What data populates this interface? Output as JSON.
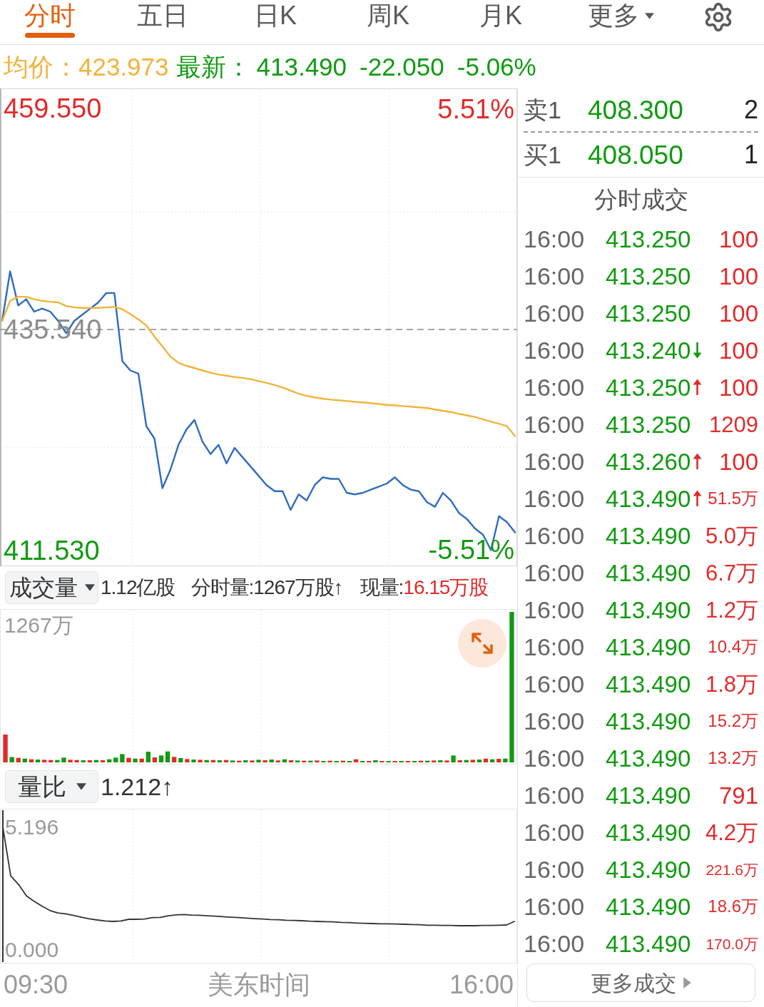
{
  "tabs": [
    {
      "label": "分时",
      "selected": true,
      "kind": "tab"
    },
    {
      "label": "五日",
      "selected": false,
      "kind": "tab"
    },
    {
      "label": "日K",
      "selected": false,
      "kind": "tab"
    },
    {
      "label": "周K",
      "selected": false,
      "kind": "tab"
    },
    {
      "label": "月K",
      "selected": false,
      "kind": "tab"
    },
    {
      "label": "更多",
      "selected": false,
      "kind": "menu"
    }
  ],
  "quote": {
    "avg_label": "均价：",
    "avg": "423.973",
    "last_label": "最新：",
    "last": "413.490",
    "change": "-22.050",
    "change_pct": "-5.06%"
  },
  "price_chart": {
    "pct_high": "5.51%",
    "pct_low": "-5.51%",
    "chart_data": {
      "type": "line",
      "ylim": [
        409.82,
        461.73
      ],
      "yticks": [
        {
          "value": 459.55,
          "label": "459.550"
        },
        {
          "value": 435.54,
          "label": "435.540"
        },
        {
          "value": 411.53,
          "label": "411.530"
        }
      ],
      "ref_lines": [
        {
          "axis": "y",
          "value": 435.54
        }
      ],
      "series": [
        {
          "color": "#2e6cc0",
          "values": [
            436.47,
            441.86,
            438.16,
            438.83,
            437.48,
            437.82,
            437.48,
            436.47,
            435.13,
            436.47,
            437.15,
            437.82,
            438.49,
            439.5,
            439.5,
            432.1,
            431.09,
            430.75,
            425.03,
            423.69,
            418.3,
            420.32,
            423.01,
            424.69,
            425.71,
            423.35,
            422.01,
            423.01,
            421.0,
            422.68,
            421.67,
            420.66,
            419.65,
            418.64,
            417.97,
            417.97,
            415.95,
            417.63,
            416.96,
            418.64,
            419.48,
            419.31,
            419.31,
            417.8,
            417.63,
            417.8,
            418.14,
            418.47,
            418.81,
            419.48,
            418.64,
            418.14,
            417.97,
            416.79,
            416.28,
            417.8,
            416.96,
            415.61,
            414.94,
            413.93,
            413.25,
            411.57,
            415.27,
            414.6,
            413.49
          ]
        },
        {
          "color": "#f0b43a",
          "values": [
            436.47,
            438.66,
            439.1,
            439.1,
            438.83,
            438.66,
            438.56,
            438.49,
            438.09,
            437.95,
            437.88,
            437.88,
            437.88,
            437.95,
            437.99,
            437.75,
            437.21,
            436.64,
            435.97,
            434.79,
            433.71,
            432.6,
            431.93,
            431.59,
            431.36,
            431.09,
            430.85,
            430.65,
            430.52,
            430.38,
            430.28,
            430.15,
            429.94,
            429.74,
            429.51,
            429.24,
            428.9,
            428.56,
            428.33,
            428.16,
            428.03,
            427.92,
            427.86,
            427.76,
            427.69,
            427.62,
            427.55,
            427.45,
            427.35,
            427.29,
            427.22,
            427.15,
            427.08,
            427.02,
            426.85,
            426.71,
            426.58,
            426.38,
            426.21,
            426.04,
            425.77,
            425.54,
            425.3,
            425.03,
            423.97
          ]
        }
      ]
    }
  },
  "volume": {
    "selector": "成交量",
    "total": "1.12亿股",
    "minute_volume": "分时量:1267万股↑",
    "current_label": "现量:",
    "current": "16.15万股",
    "max_label": "1267万"
  },
  "ratio": {
    "selector": "量比",
    "value": "1.212↑",
    "chart_data": {
      "type": "line",
      "ylim": [
        -0.54,
        5.95
      ],
      "yticks": [
        {
          "value": 5.196,
          "label": "5.196"
        },
        {
          "value": 0,
          "label": "0.000"
        }
      ],
      "series": [
        {
          "color": "#333333",
          "values": [
            5.196,
            3.14,
            2.77,
            2.29,
            2.06,
            1.85,
            1.67,
            1.57,
            1.53,
            1.46,
            1.39,
            1.32,
            1.27,
            1.23,
            1.21,
            1.23,
            1.3,
            1.3,
            1.31,
            1.37,
            1.38,
            1.45,
            1.49,
            1.5,
            1.48,
            1.47,
            1.45,
            1.43,
            1.41,
            1.39,
            1.37,
            1.35,
            1.33,
            1.31,
            1.29,
            1.28,
            1.26,
            1.25,
            1.24,
            1.22,
            1.21,
            1.2,
            1.19,
            1.17,
            1.16,
            1.14,
            1.13,
            1.12,
            1.11,
            1.11,
            1.1,
            1.09,
            1.08,
            1.07,
            1.05,
            1.05,
            1.04,
            1.04,
            1.03,
            1.03,
            1.03,
            1.04,
            1.04,
            1.05,
            1.06,
            1.21
          ]
        }
      ]
    }
  },
  "time_axis": [
    "09:30",
    "美东时间",
    "16:00"
  ],
  "order_book": [
    {
      "label": "卖1",
      "price": "408.300",
      "volume": "2"
    },
    {
      "label": "买1",
      "price": "408.050",
      "volume": "1"
    }
  ],
  "trades_title": "分时成交",
  "trades": [
    {
      "time": "16:00",
      "price": "413.250",
      "arrow_up": false,
      "arrow_down": false,
      "volume": "100"
    },
    {
      "time": "16:00",
      "price": "413.250",
      "arrow_up": false,
      "arrow_down": false,
      "volume": "100"
    },
    {
      "time": "16:00",
      "price": "413.250",
      "arrow_up": false,
      "arrow_down": false,
      "volume": "100"
    },
    {
      "time": "16:00",
      "price": "413.240",
      "arrow_up": false,
      "arrow_down": true,
      "volume": "100"
    },
    {
      "time": "16:00",
      "price": "413.250",
      "arrow_up": true,
      "arrow_down": false,
      "volume": "100"
    },
    {
      "time": "16:00",
      "price": "413.250",
      "arrow_up": false,
      "arrow_down": false,
      "volume": "1209"
    },
    {
      "time": "16:00",
      "price": "413.260",
      "arrow_up": true,
      "arrow_down": false,
      "volume": "100"
    },
    {
      "time": "16:00",
      "price": "413.490",
      "arrow_up": true,
      "arrow_down": false,
      "volume": "51.5万"
    },
    {
      "time": "16:00",
      "price": "413.490",
      "arrow_up": false,
      "arrow_down": false,
      "volume": "5.0万"
    },
    {
      "time": "16:00",
      "price": "413.490",
      "arrow_up": false,
      "arrow_down": false,
      "volume": "6.7万"
    },
    {
      "time": "16:00",
      "price": "413.490",
      "arrow_up": false,
      "arrow_down": false,
      "volume": "1.2万"
    },
    {
      "time": "16:00",
      "price": "413.490",
      "arrow_up": false,
      "arrow_down": false,
      "volume": "10.4万"
    },
    {
      "time": "16:00",
      "price": "413.490",
      "arrow_up": false,
      "arrow_down": false,
      "volume": "1.8万"
    },
    {
      "time": "16:00",
      "price": "413.490",
      "arrow_up": false,
      "arrow_down": false,
      "volume": "15.2万"
    },
    {
      "time": "16:00",
      "price": "413.490",
      "arrow_up": false,
      "arrow_down": false,
      "volume": "13.2万"
    },
    {
      "time": "16:00",
      "price": "413.490",
      "arrow_up": false,
      "arrow_down": false,
      "volume": "791"
    },
    {
      "time": "16:00",
      "price": "413.490",
      "arrow_up": false,
      "arrow_down": false,
      "volume": "4.2万"
    },
    {
      "time": "16:00",
      "price": "413.490",
      "arrow_up": false,
      "arrow_down": false,
      "volume": "221.6万"
    },
    {
      "time": "16:00",
      "price": "413.490",
      "arrow_up": false,
      "arrow_down": false,
      "volume": "18.6万"
    },
    {
      "time": "16:00",
      "price": "413.490",
      "arrow_up": false,
      "arrow_down": false,
      "volume": "170.0万"
    }
  ],
  "more_button": "更多成交"
}
